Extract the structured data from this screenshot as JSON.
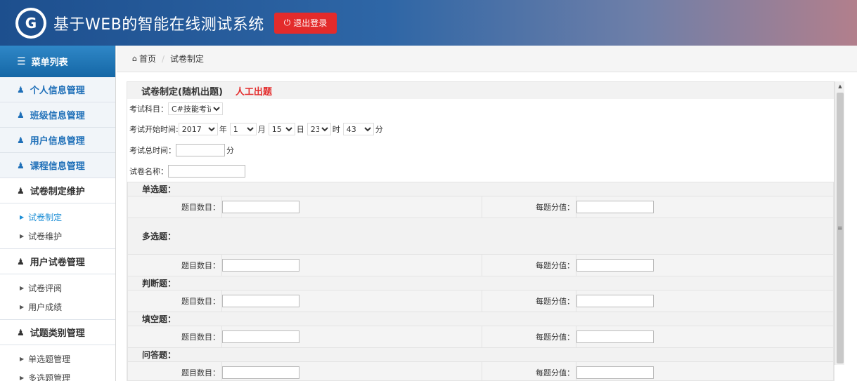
{
  "header": {
    "logo_glyph": "G",
    "title": "基于WEB的智能在线测试系统",
    "logout_label": "退出登录",
    "logout_color": "#e32b2b"
  },
  "sidebar": {
    "menu_title": "菜单列表",
    "items": [
      {
        "label": "个人信息管理"
      },
      {
        "label": "班级信息管理"
      },
      {
        "label": "用户信息管理"
      },
      {
        "label": "课程信息管理"
      },
      {
        "label": "试卷制定维护",
        "children": [
          {
            "label": "试卷制定"
          },
          {
            "label": "试卷维护"
          }
        ]
      },
      {
        "label": "用户试卷管理",
        "children": [
          {
            "label": "试卷评阅"
          },
          {
            "label": "用户成绩"
          }
        ]
      },
      {
        "label": "试题类别管理",
        "children": [
          {
            "label": "单选题管理"
          },
          {
            "label": "多选题管理"
          }
        ]
      }
    ]
  },
  "breadcrumb": {
    "home": "首页",
    "current": "试卷制定"
  },
  "form": {
    "title": "试卷制定(随机出题)",
    "manual_link": "人工出题",
    "subject_label": "考试科目：",
    "subject_value": "C#技能考试",
    "start_label": "考试开始时间:",
    "year": "2017",
    "year_unit": "年",
    "month": "1",
    "month_unit": "月",
    "day": "15",
    "day_unit": "日",
    "hour": "23",
    "hour_unit": "时",
    "minute": "43",
    "minute_unit": "分",
    "total_label": "考试总时间：",
    "total_unit": "分",
    "name_label": "试卷名称：",
    "count_label": "题目数目：",
    "score_label": "每题分值：",
    "sections": [
      "单选题：",
      "多选题：",
      "判断题：",
      "填空题：",
      "问答题："
    ]
  }
}
